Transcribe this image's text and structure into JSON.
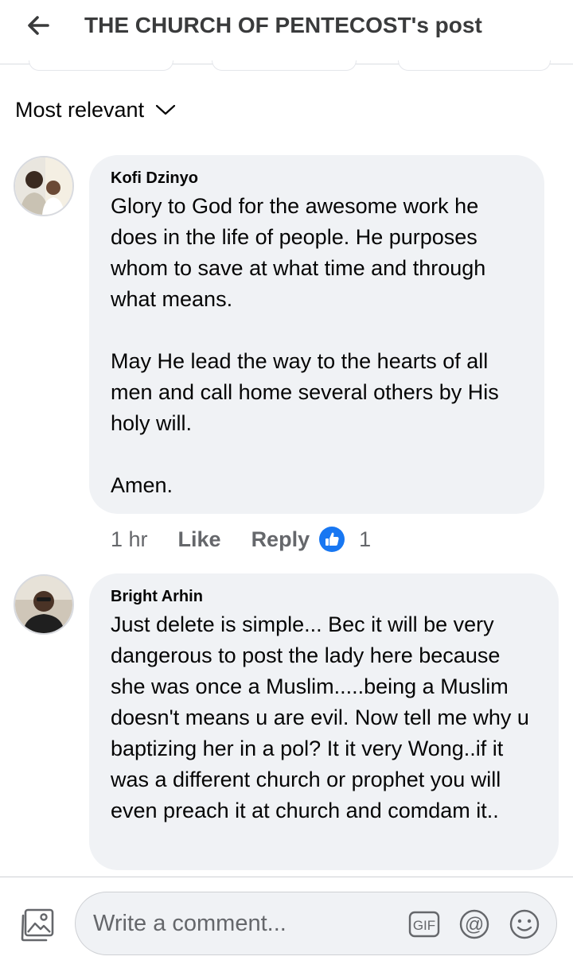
{
  "header": {
    "title": "THE CHURCH OF PENTECOST's post"
  },
  "sort": {
    "label": "Most relevant"
  },
  "comments": [
    {
      "author": "Kofi Dzinyo",
      "text": "Glory to God for the awesome work he does in the life of people. He purposes whom to save at what time and through what means.\n\nMay He lead the way to the hearts of all men and call home several others by His holy will.\n\nAmen.",
      "time": "1 hr",
      "like_label": "Like",
      "reply_label": "Reply",
      "reaction_count": "1"
    },
    {
      "author": "Bright Arhin",
      "text": "Just delete is simple... Bec it will be very dangerous to post the lady here because she was once a Muslim.....being a Muslim doesn't means u are evil. Now tell me why u baptizing her in a pol? It it very Wong..if it was a different church or prophet you will even preach it at church and comdam it.."
    }
  ],
  "composer": {
    "placeholder": "Write a comment..."
  },
  "colors": {
    "bubble": "#f0f2f5",
    "like_blue": "#1877f2",
    "secondary_text": "#65676b"
  }
}
